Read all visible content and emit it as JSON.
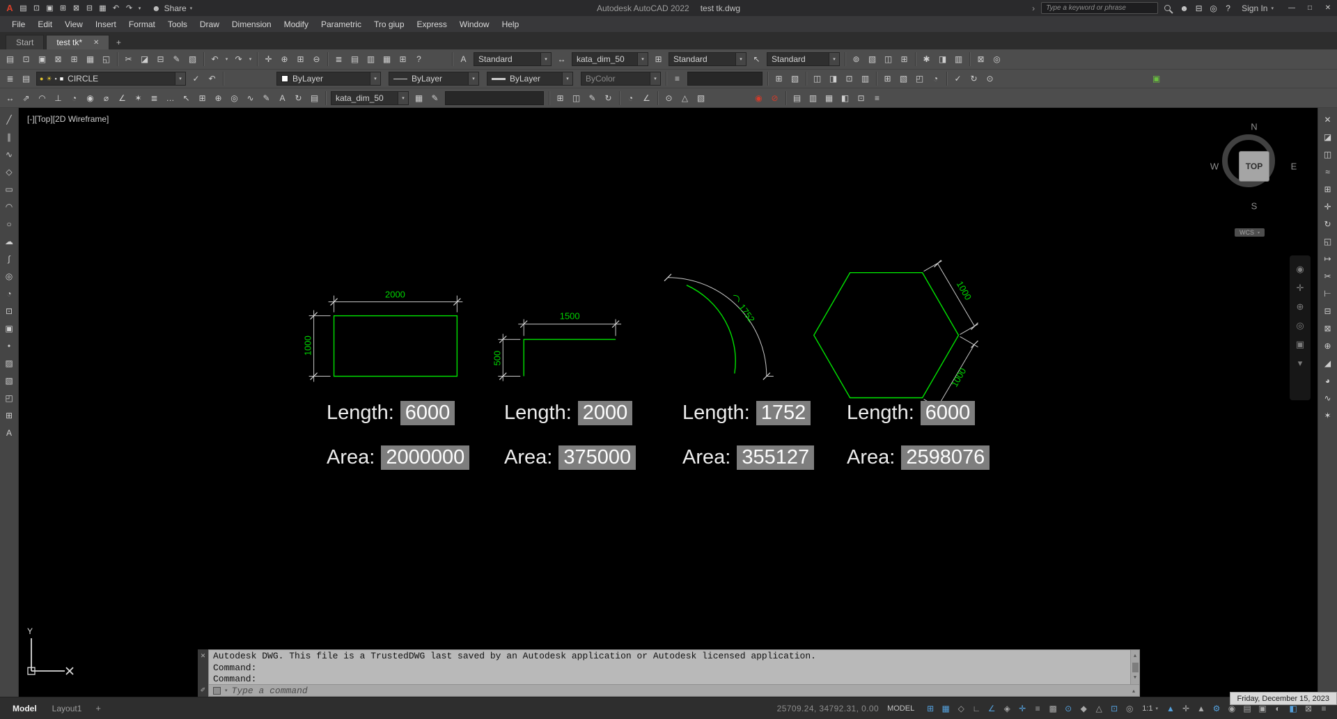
{
  "titlebar": {
    "app_name": "Autodesk AutoCAD 2022",
    "doc_name": "test tk.dwg",
    "share_label": "Share",
    "search_placeholder": "Type a keyword or phrase",
    "sign_in": "Sign In",
    "qat_icons": [
      {
        "name": "qnew-icon",
        "glyph": "▤"
      },
      {
        "name": "open-icon",
        "glyph": "⊡"
      },
      {
        "name": "save-icon",
        "glyph": "▣"
      },
      {
        "name": "save-as-icon",
        "glyph": "⊞"
      },
      {
        "name": "open-from-web-icon",
        "glyph": "⊠"
      },
      {
        "name": "save-to-web-icon",
        "glyph": "⊟"
      },
      {
        "name": "plot-icon",
        "glyph": "▦"
      },
      {
        "name": "undo-icon",
        "glyph": "↶"
      },
      {
        "name": "redo-icon",
        "glyph": "↷"
      }
    ],
    "right_icons": [
      {
        "name": "avatar",
        "glyph": "☻"
      },
      {
        "name": "cart-icon",
        "glyph": "⊟"
      },
      {
        "name": "notification-icon",
        "glyph": "◎"
      },
      {
        "name": "help-icon",
        "glyph": "?"
      }
    ],
    "window_controls": [
      {
        "name": "minimize-button",
        "glyph": "—"
      },
      {
        "name": "maximize-button",
        "glyph": "□"
      },
      {
        "name": "close-button",
        "glyph": "✕"
      }
    ]
  },
  "menubar": {
    "items": [
      "File",
      "Edit",
      "View",
      "Insert",
      "Format",
      "Tools",
      "Draw",
      "Dimension",
      "Modify",
      "Parametric",
      "Tro giup",
      "Express",
      "Window",
      "Help"
    ]
  },
  "tabs": {
    "start": "Start",
    "active": "test tk*"
  },
  "toolbars": {
    "std": {
      "file_icons": [
        {
          "name": "qnew-icon",
          "glyph": "▤"
        },
        {
          "name": "open-icon",
          "glyph": "⊡"
        },
        {
          "name": "save-icon",
          "glyph": "▣"
        },
        {
          "name": "open-from-web-icon",
          "glyph": "⊠"
        },
        {
          "name": "save-to-web-icon",
          "glyph": "⊞"
        },
        {
          "name": "plot-icon",
          "glyph": "▦"
        },
        {
          "name": "plot-preview-icon",
          "glyph": "◱"
        }
      ],
      "edit_icons": [
        {
          "name": "cut-icon",
          "glyph": "✂"
        },
        {
          "name": "copy-icon",
          "glyph": "◪"
        },
        {
          "name": "paste-icon",
          "glyph": "⊟"
        },
        {
          "name": "match-properties-icon",
          "glyph": "✎"
        },
        {
          "name": "block-editor-icon",
          "glyph": "▧"
        }
      ],
      "zoom_icons": [
        {
          "name": "pan-icon",
          "glyph": "✛"
        },
        {
          "name": "zoom-realtime-icon",
          "glyph": "⊕"
        },
        {
          "name": "zoom-window-icon",
          "glyph": "⊞"
        },
        {
          "name": "zoom-previous-icon",
          "glyph": "⊖"
        }
      ],
      "palette_icons": [
        {
          "name": "properties-palette-icon",
          "glyph": "≣"
        },
        {
          "name": "designcenter-icon",
          "glyph": "▤"
        },
        {
          "name": "tool-palettes-icon",
          "glyph": "▥"
        },
        {
          "name": "sheet-set-manager-icon",
          "glyph": "▦"
        },
        {
          "name": "quickcalc-icon",
          "glyph": "⊞"
        },
        {
          "name": "help-icon",
          "glyph": "?"
        }
      ],
      "text_style_icon": "A",
      "text_style": "Standard",
      "dim_style_icon": "↔",
      "dim_style": "kata_dim_50",
      "table_style_icon": "⊞",
      "table_style": "Standard",
      "mleader_style_icon": "↖",
      "mleader_style": "Standard",
      "right_icons_a": [
        {
          "name": "toolbar-icon",
          "glyph": "⊚"
        },
        {
          "name": "toolbar-icon",
          "glyph": "▧"
        },
        {
          "name": "toolbar-icon",
          "glyph": "◫"
        },
        {
          "name": "toolbar-icon",
          "glyph": "⊞"
        }
      ],
      "right_icons_b": [
        {
          "name": "toolbar-icon",
          "glyph": "✱"
        },
        {
          "name": "toolbar-icon",
          "glyph": "◨"
        },
        {
          "name": "toolbar-icon",
          "glyph": "▥"
        }
      ],
      "right_icons_c": [
        {
          "name": "toolbar-icon",
          "glyph": "⊠"
        },
        {
          "name": "toolbar-icon",
          "glyph": "◎"
        }
      ]
    },
    "layers": {
      "left_icons": [
        {
          "name": "layer-properties-icon",
          "glyph": "≣"
        },
        {
          "name": "layer-states-icon",
          "glyph": "▤"
        }
      ],
      "status_icons": [
        {
          "name": "layer-on-icon",
          "glyph": "●",
          "color": "#e6c832"
        },
        {
          "name": "layer-freeze-icon",
          "glyph": "☀",
          "color": "#e6c832"
        },
        {
          "name": "layer-lock-icon",
          "glyph": "▪",
          "color": "#cfcfcf"
        },
        {
          "name": "layer-color-swatch",
          "glyph": "■",
          "color": "#ffffff"
        }
      ],
      "layer_name": "CIRCLE",
      "mid_icons": [
        {
          "name": "make-object-layer-current-icon",
          "glyph": "✓"
        },
        {
          "name": "layer-previous-icon",
          "glyph": "↶"
        }
      ],
      "color": "ByLayer",
      "linetype": "ByLayer",
      "lineweight": "ByLayer",
      "plot_style": "ByColor",
      "field_value": "",
      "list_icon": "≡",
      "right_icons_a": [
        {
          "name": "toolbar-icon",
          "glyph": "⊞"
        },
        {
          "name": "toolbar-icon",
          "glyph": "▧"
        }
      ],
      "right_icons_b": [
        {
          "name": "toolbar-icon",
          "glyph": "◫"
        },
        {
          "name": "toolbar-icon",
          "glyph": "◨"
        },
        {
          "name": "toolbar-icon",
          "glyph": "⊡"
        },
        {
          "name": "toolbar-icon",
          "glyph": "▥"
        }
      ],
      "right_icons_c": [
        {
          "name": "toolbar-icon",
          "glyph": "⊞"
        },
        {
          "name": "toolbar-icon",
          "glyph": "▧"
        },
        {
          "name": "toolbar-icon",
          "glyph": "◰"
        },
        {
          "name": "toolbar-icon",
          "glyph": "◔"
        }
      ],
      "right_icons_d": [
        {
          "name": "toolbar-icon",
          "glyph": "✓"
        },
        {
          "name": "toolbar-icon",
          "glyph": "↻"
        },
        {
          "name": "toolbar-icon",
          "glyph": "⊙"
        }
      ],
      "green_icon": {
        "glyph": "▣"
      }
    },
    "dim": {
      "icons": [
        {
          "name": "linear-dim-icon",
          "glyph": "↔"
        },
        {
          "name": "aligned-dim-icon",
          "glyph": "⇗"
        },
        {
          "name": "arc-length-dim-icon",
          "glyph": "◠"
        },
        {
          "name": "ordinate-dim-icon",
          "glyph": "⊥"
        },
        {
          "name": "radius-dim-icon",
          "glyph": "◔"
        },
        {
          "name": "jogged-dim-icon",
          "glyph": "◉"
        },
        {
          "name": "diameter-dim-icon",
          "glyph": "⌀"
        },
        {
          "name": "angular-dim-icon",
          "glyph": "∠"
        },
        {
          "name": "quick-dim-icon",
          "glyph": "✶"
        },
        {
          "name": "baseline-dim-icon",
          "glyph": "≣"
        },
        {
          "name": "continue-dim-icon",
          "glyph": "…"
        },
        {
          "name": "leader-icon",
          "glyph": "↖"
        },
        {
          "name": "tolerance-icon",
          "glyph": "⊞"
        },
        {
          "name": "center-mark-icon",
          "glyph": "⊕"
        },
        {
          "name": "inspection-dim-icon",
          "glyph": "◎"
        },
        {
          "name": "jogged-linear-icon",
          "glyph": "∿"
        },
        {
          "name": "dim-edit-icon",
          "glyph": "✎"
        },
        {
          "name": "dim-text-edit-icon",
          "glyph": "A"
        },
        {
          "name": "dim-update-icon",
          "glyph": "↻"
        },
        {
          "name": "dim-space-icon",
          "glyph": "▤"
        }
      ],
      "style": "kata_dim_50",
      "after_icons": [
        {
          "name": "dim-style-dialog-icon",
          "glyph": "▦"
        },
        {
          "name": "dim-override-icon",
          "glyph": "✎"
        }
      ],
      "field_value": "",
      "right_icons_a": [
        {
          "name": "toolbar-icon",
          "glyph": "⊞"
        },
        {
          "name": "toolbar-icon",
          "glyph": "◫"
        },
        {
          "name": "toolbar-icon",
          "glyph": "✎"
        },
        {
          "name": "toolbar-icon",
          "glyph": "↻"
        }
      ],
      "right_icons_b": [
        {
          "name": "toolbar-icon",
          "glyph": "◔"
        },
        {
          "name": "toolbar-icon",
          "glyph": "∠"
        }
      ],
      "right_icons_c": [
        {
          "name": "toolbar-icon",
          "glyph": "⊙"
        },
        {
          "name": "toolbar-icon",
          "glyph": "△"
        },
        {
          "name": "toolbar-icon",
          "glyph": "▧"
        }
      ],
      "warn_icons": [
        {
          "name": "annotation-alert-icon",
          "glyph": "◉",
          "color": "#d23b2a"
        },
        {
          "name": "annotation-alert-icon",
          "glyph": "⊘",
          "color": "#d23b2a"
        }
      ],
      "end_icons": [
        {
          "name": "toolbar-icon",
          "glyph": "▤"
        },
        {
          "name": "toolbar-icon",
          "glyph": "▥"
        },
        {
          "name": "toolbar-icon",
          "glyph": "▦"
        },
        {
          "name": "toolbar-icon",
          "glyph": "◧"
        },
        {
          "name": "toolbar-icon",
          "glyph": "⊡"
        },
        {
          "name": "toolbar-icon",
          "glyph": "≡"
        }
      ]
    }
  },
  "draw_toolbar": [
    {
      "name": "line-icon",
      "glyph": "╱"
    },
    {
      "name": "construction-line-icon",
      "glyph": "∥"
    },
    {
      "name": "polyline-icon",
      "glyph": "∿"
    },
    {
      "name": "polygon-icon",
      "glyph": "◇"
    },
    {
      "name": "rectangle-icon",
      "glyph": "▭"
    },
    {
      "name": "arc-icon",
      "glyph": "◠"
    },
    {
      "name": "circle-icon",
      "glyph": "○"
    },
    {
      "name": "revcloud-icon",
      "glyph": "☁"
    },
    {
      "name": "spline-icon",
      "glyph": "∫"
    },
    {
      "name": "ellipse-icon",
      "glyph": "◎"
    },
    {
      "name": "ellipse-arc-icon",
      "glyph": "◔"
    },
    {
      "name": "insert-block-icon",
      "glyph": "⊡"
    },
    {
      "name": "make-block-icon",
      "glyph": "▣"
    },
    {
      "name": "point-icon",
      "glyph": "•"
    },
    {
      "name": "hatch-icon",
      "glyph": "▨"
    },
    {
      "name": "gradient-icon",
      "glyph": "▧"
    },
    {
      "name": "region-icon",
      "glyph": "◰"
    },
    {
      "name": "table-icon",
      "glyph": "⊞"
    },
    {
      "name": "mtext-icon",
      "glyph": "A"
    }
  ],
  "modify_toolbar": [
    {
      "name": "erase-icon",
      "glyph": "✕"
    },
    {
      "name": "copy-icon",
      "glyph": "◪"
    },
    {
      "name": "mirror-icon",
      "glyph": "◫"
    },
    {
      "name": "offset-icon",
      "glyph": "≈"
    },
    {
      "name": "array-icon",
      "glyph": "⊞"
    },
    {
      "name": "move-icon",
      "glyph": "✛"
    },
    {
      "name": "rotate-icon",
      "glyph": "↻"
    },
    {
      "name": "scale-icon",
      "glyph": "◱"
    },
    {
      "name": "stretch-icon",
      "glyph": "↦"
    },
    {
      "name": "trim-icon",
      "glyph": "✂"
    },
    {
      "name": "extend-icon",
      "glyph": "⊢"
    },
    {
      "name": "break-at-point-icon",
      "glyph": "⊟"
    },
    {
      "name": "break-icon",
      "glyph": "⊠"
    },
    {
      "name": "join-icon",
      "glyph": "⊕"
    },
    {
      "name": "chamfer-icon",
      "glyph": "◢"
    },
    {
      "name": "fillet-icon",
      "glyph": "◕"
    },
    {
      "name": "blend-curves-icon",
      "glyph": "∿"
    },
    {
      "name": "explode-icon",
      "glyph": "✶"
    }
  ],
  "viewport": {
    "corner_label": [
      "[-]",
      "[Top]",
      "[2D Wireframe]"
    ],
    "viewcube": {
      "north": "N",
      "south": "S",
      "east": "E",
      "west": "W",
      "top": "TOP",
      "wcs": "WCS"
    },
    "navbar_icons": [
      {
        "name": "navigation-wheel-icon",
        "glyph": "◉"
      },
      {
        "name": "pan-icon",
        "glyph": "✛"
      },
      {
        "name": "zoom-icon",
        "glyph": "⊕"
      },
      {
        "name": "orbit-icon",
        "glyph": "◎"
      },
      {
        "name": "showmotion-icon",
        "glyph": "▣"
      },
      {
        "name": "navbar-more-icon",
        "glyph": "▾"
      }
    ],
    "ucs": {
      "y_label": "Y"
    },
    "dims": {
      "rect_width": "2000",
      "rect_height": "1000",
      "path_width": "1500",
      "path_height": "500",
      "arc_length": "1752",
      "hex_edge_top": "1000",
      "hex_edge_bottom": "1000"
    },
    "labels": {
      "length": "Length:",
      "area": "Area:"
    },
    "annotations": [
      {
        "length": "6000",
        "area": "2000000"
      },
      {
        "length": "2000",
        "area": "375000"
      },
      {
        "length": "1752",
        "area": "355127"
      },
      {
        "length": "6000",
        "area": "2598076"
      }
    ]
  },
  "command": {
    "history": [
      "Autodesk DWG.  This file is a TrustedDWG last saved by an Autodesk application or Autodesk licensed application.",
      "Command:",
      "Command:"
    ],
    "placeholder": "Type a command"
  },
  "statusbar": {
    "model_tab": "Model",
    "layout_tab": "Layout1",
    "new_layout": "+",
    "coordinates": "25709.24, 34792.31, 0.00",
    "mode": "MODEL",
    "icons_a": [
      {
        "name": "grid-icon",
        "glyph": "⊞",
        "active": true
      },
      {
        "name": "snap-icon",
        "glyph": "▦",
        "active": true
      },
      {
        "name": "infer-constraints-icon",
        "glyph": "◇"
      },
      {
        "name": "ortho-icon",
        "glyph": "∟"
      },
      {
        "name": "polar-tracking-icon",
        "glyph": "∠",
        "active": true
      },
      {
        "name": "isodraft-icon",
        "glyph": "◈"
      },
      {
        "name": "object-snap-tracking-icon",
        "glyph": "✛",
        "active": true
      },
      {
        "name": "lineweight-display-icon",
        "glyph": "≡"
      },
      {
        "name": "transparency-icon",
        "glyph": "▩"
      },
      {
        "name": "object-snap-icon",
        "glyph": "⊙",
        "active": true
      },
      {
        "name": "object-snap-3d-icon",
        "glyph": "◆"
      },
      {
        "name": "dynamic-ucs-icon",
        "glyph": "△"
      },
      {
        "name": "dynamic-input-icon",
        "glyph": "⊡",
        "active": true
      },
      {
        "name": "selection-cycling-icon",
        "glyph": "◎"
      }
    ],
    "scale": "1:1",
    "icons_b": [
      {
        "name": "annotation-visibility-icon",
        "glyph": "▲",
        "active": true
      },
      {
        "name": "autoscale-icon",
        "glyph": "✛"
      },
      {
        "name": "annotation-scale-icon",
        "glyph": "▲"
      },
      {
        "name": "workspace-switching-icon",
        "glyph": "⚙",
        "active": true
      },
      {
        "name": "annotation-monitor-icon",
        "glyph": "◉"
      },
      {
        "name": "quick-properties-icon",
        "glyph": "▤"
      },
      {
        "name": "lock-ui-icon",
        "glyph": "▣"
      },
      {
        "name": "isolate-objects-icon",
        "glyph": "◐"
      },
      {
        "name": "hardware-acceleration-icon",
        "glyph": "◧",
        "active": true
      },
      {
        "name": "clean-screen-icon",
        "glyph": "⊠"
      },
      {
        "name": "customization-icon",
        "glyph": "≡"
      }
    ],
    "datetime": "Friday, December 15, 2023"
  }
}
